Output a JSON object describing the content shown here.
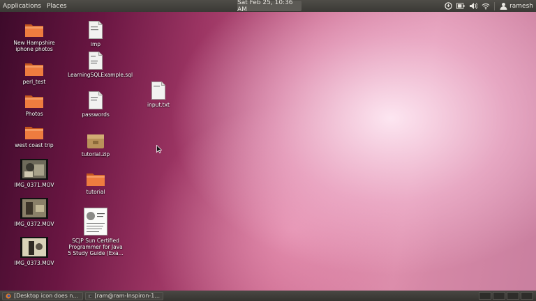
{
  "top_panel": {
    "menus": [
      "Applications",
      "Places"
    ],
    "clock": "Sat Feb 25, 10:36 AM",
    "user": "ramesh",
    "tray_icons": [
      "updates-icon",
      "battery-icon",
      "volume-icon",
      "wifi-icon",
      "user-icon"
    ]
  },
  "desktop_icons": [
    {
      "id": "new-hampshire",
      "label": "New Hampshire iphone photos",
      "kind": "folder"
    },
    {
      "id": "perl-test",
      "label": "perl_test",
      "kind": "folder"
    },
    {
      "id": "photos",
      "label": "Photos",
      "kind": "folder"
    },
    {
      "id": "west-coast",
      "label": "west coast trip",
      "kind": "folder"
    },
    {
      "id": "img0371",
      "label": "IMG_0371.MOV",
      "kind": "video"
    },
    {
      "id": "img0372",
      "label": "IMG_0372.MOV",
      "kind": "video"
    },
    {
      "id": "img0373",
      "label": "IMG_0373.MOV",
      "kind": "video"
    },
    {
      "id": "imp",
      "label": "imp",
      "kind": "text",
      "preview": "9320\ndrnw"
    },
    {
      "id": "learningsql",
      "label": "LearningSQLExample.sql",
      "kind": "text",
      "preview": "/* le\n\ncreat\ntime"
    },
    {
      "id": "passwords",
      "label": "passwords",
      "kind": "text",
      "preview": "mysql\ndatat"
    },
    {
      "id": "tutorial-zip",
      "label": "tutorial.zip",
      "kind": "zip",
      "preview": "zip"
    },
    {
      "id": "tutorial",
      "label": "tutorial",
      "kind": "folder"
    },
    {
      "id": "scjp",
      "label": "SCJP Sun Certified Programmer for Java 5 Study Guide (Exa...",
      "kind": "pdf"
    },
    {
      "id": "input-txt",
      "label": "input.txt",
      "kind": "text",
      "preview": "3 4 1"
    }
  ],
  "taskbar": {
    "tasks": [
      "[Desktop icon does n...",
      "[ram@ram-Inspiron-1..."
    ]
  },
  "colors": {
    "folder": "#e8743b",
    "panel": "#3c3b37"
  }
}
